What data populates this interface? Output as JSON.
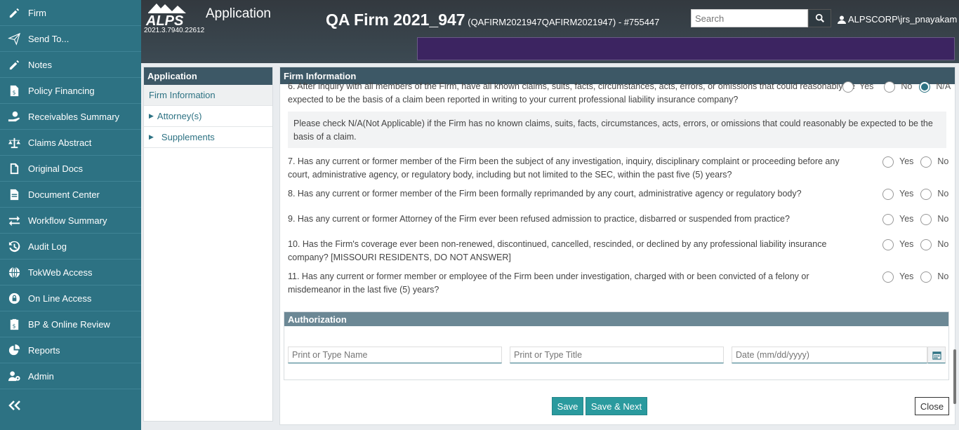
{
  "sidebar": {
    "items": [
      {
        "label": "Firm",
        "icon": "pencil-icon"
      },
      {
        "label": "Send To...",
        "icon": "paper-plane-icon"
      },
      {
        "label": "Notes",
        "icon": "pencil-icon"
      },
      {
        "label": "Policy Financing",
        "icon": "document-dollar-icon"
      },
      {
        "label": "Receivables Summary",
        "icon": "hand-money-icon"
      },
      {
        "label": "Claims Abstract",
        "icon": "balance-scale-icon"
      },
      {
        "label": "Original Docs",
        "icon": "file-icon"
      },
      {
        "label": "Document Center",
        "icon": "file-text-icon"
      },
      {
        "label": "Workflow Summary",
        "icon": "exchange-arrows-icon"
      },
      {
        "label": "Audit Log",
        "icon": "history-icon"
      },
      {
        "label": "TokWeb Access",
        "icon": "globe-icon"
      },
      {
        "label": "On Line Access",
        "icon": "lock-icon"
      },
      {
        "label": "BP & Online Review",
        "icon": "clipboard-dollar-icon"
      },
      {
        "label": "Reports",
        "icon": "pie-chart-icon"
      },
      {
        "label": "Admin",
        "icon": "users-cog-icon"
      }
    ],
    "collapse_icon": "double-chevron-left-icon"
  },
  "header": {
    "logo_text": "ALPS",
    "app_title": "Application",
    "version": "2021.3.7940.22612",
    "firm_name": "QA Firm 2021_947",
    "firm_meta": "(QAFIRM2021947QAFIRM2021947) - #755447",
    "search_placeholder": "Search",
    "user": "ALPSCORP\\jrs_pnayakam",
    "banner_color": "#3c2461"
  },
  "app_nav": {
    "title": "Application",
    "items": [
      {
        "label": "Firm Information",
        "active": true
      },
      {
        "label": "Attorney(s)",
        "caret": "▶"
      },
      {
        "label": "Supplements",
        "caret": "▶"
      }
    ]
  },
  "main": {
    "section_title": "Firm Information",
    "questions": [
      {
        "text": "6. After inquiry with all members of the Firm, have all known claims, suits, facts, circumstances, acts, errors, or omissions that could reasonably be expected to be the basis of a claim been reported in writing to your current professional liability insurance company?",
        "options": [
          "Yes",
          "No",
          "N/A"
        ],
        "selected": "N/A"
      },
      {
        "text": "7. Has any current or former member of the Firm been the subject of any investigation, inquiry, disciplinary complaint or proceeding before any court, administrative agency, or regulatory body, including but not limited to the SEC, within the past five (5) years?",
        "options": [
          "Yes",
          "No"
        ]
      },
      {
        "text": "8. Has any current or former member of the Firm been formally reprimanded by any court, administrative agency or regulatory body?",
        "options": [
          "Yes",
          "No"
        ]
      },
      {
        "text": "9. Has any current or former Attorney of the Firm ever been refused admission to practice, disbarred or suspended from practice?",
        "options": [
          "Yes",
          "No"
        ]
      },
      {
        "text": "10. Has the Firm's coverage ever been non-renewed, discontinued, cancelled, rescinded, or declined by any professional liability insurance company? [MISSOURI RESIDENTS, DO NOT ANSWER]",
        "options": [
          "Yes",
          "No"
        ]
      },
      {
        "text": "11. Has any current or former member or employee of the Firm been under investigation, charged with or been convicted of a felony or misdemeanor in the last five (5) years?",
        "options": [
          "Yes",
          "No"
        ]
      }
    ],
    "note": "Please check N/A(Not Applicable) if the Firm has no known claims, suits, facts, circumstances, acts, errors, or omissions that could reasonably be expected to be the basis of a claim.",
    "authorization": {
      "title": "Authorization",
      "name_placeholder": "Print or Type Name",
      "title_placeholder": "Print or Type Title",
      "date_placeholder": "Date (mm/dd/yyyy)"
    },
    "buttons": {
      "save": "Save",
      "save_next": "Save & Next",
      "close": "Close"
    }
  },
  "colors": {
    "sidebar": "#2d7283",
    "section_header": "#3d5866",
    "primary_button": "#2a9a9e"
  }
}
